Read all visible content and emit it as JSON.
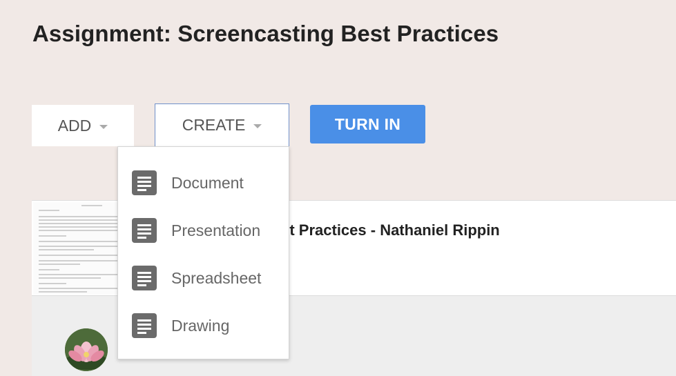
{
  "assignment": {
    "title": "Assignment: Screencasting Best Practices"
  },
  "toolbar": {
    "add_label": "ADD",
    "create_label": "CREATE",
    "turn_in_label": "TURN IN"
  },
  "create_menu": {
    "items": [
      {
        "label": "Document",
        "icon": "doc-icon"
      },
      {
        "label": "Presentation",
        "icon": "doc-icon"
      },
      {
        "label": "Spreadsheet",
        "icon": "doc-icon"
      },
      {
        "label": "Drawing",
        "icon": "doc-icon"
      }
    ]
  },
  "attachment": {
    "title_visible": "ng Best Practices - Nathaniel Rippin"
  },
  "colors": {
    "page_background": "#f1e9e6",
    "turn_in_button": "#4a8fe7",
    "create_border": "#6e8fc9",
    "menu_icon": "#6b6b6b"
  }
}
